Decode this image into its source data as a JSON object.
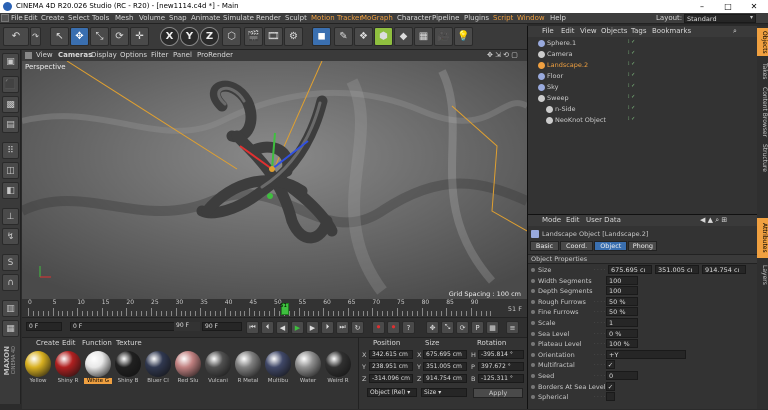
{
  "window": {
    "title": "CINEMA 4D R20.026 Studio (RC - R20) - [new1114.c4d *] - Main"
  },
  "menu": [
    "File",
    "Edit",
    "Create",
    "Select",
    "Tools",
    "Mesh",
    "Volume",
    "Snap",
    "Animate",
    "Simulate",
    "Render",
    "Sculpt",
    "Motion Tracker",
    "MoGraph",
    "Character",
    "Pipeline",
    "Plugins",
    "Script",
    "Window",
    "Help"
  ],
  "layout": {
    "label": "Layout:",
    "value": "Standard"
  },
  "viewport": {
    "menu": [
      "View",
      "Cameras",
      "Display",
      "Options",
      "Filter",
      "Panel",
      "ProRender"
    ],
    "name": "Perspective",
    "grid_spacing": "Grid Spacing : 100 cm"
  },
  "timeline": {
    "ticks": [
      "0",
      "5",
      "10",
      "15",
      "20",
      "25",
      "30",
      "35",
      "40",
      "45",
      "50",
      "55",
      "60",
      "65",
      "70",
      "75",
      "80",
      "85",
      "90"
    ],
    "current_marker": "51",
    "frame_end": "51 F"
  },
  "transport": {
    "start": "0 F",
    "current": "0 F",
    "end_a": "90 F",
    "end_b": "90 F"
  },
  "materials": {
    "menu": [
      "Create",
      "Edit",
      "Function",
      "Texture"
    ],
    "items": [
      {
        "label": "Yellow",
        "color": "#d8b020"
      },
      {
        "label": "Shiny R",
        "color": "#b02020"
      },
      {
        "label": "White G",
        "color": "#e8e8e8"
      },
      {
        "label": "Shiny B",
        "color": "#202020"
      },
      {
        "label": "Bluer Cl",
        "color": "#303850"
      },
      {
        "label": "Red Slu",
        "color": "#c08080"
      },
      {
        "label": "Vulcani",
        "color": "#505050"
      },
      {
        "label": "R Metal",
        "color": "#808080"
      },
      {
        "label": "Multibu",
        "color": "#404868"
      },
      {
        "label": "Water",
        "color": "#909090"
      },
      {
        "label": "Weird R",
        "color": "#303030"
      }
    ]
  },
  "coords": {
    "headers": [
      "Position",
      "Size",
      "Rotation"
    ],
    "rows": [
      {
        "axis": "X",
        "pos": "342.615 cm",
        "size": "675.695 cm",
        "rlabel": "H",
        "rot": "-395.814 °"
      },
      {
        "axis": "Y",
        "pos": "238.951 cm",
        "size": "351.005 cm",
        "rlabel": "P",
        "rot": "397.672 °"
      },
      {
        "axis": "Z",
        "pos": "-314.096 cm",
        "size": "914.754 cm",
        "rlabel": "B",
        "rot": "-125.311 °"
      }
    ],
    "mode": "Object (Rel)",
    "size_mode": "Size",
    "apply": "Apply"
  },
  "objects": {
    "menu": [
      "File",
      "Edit",
      "View",
      "Objects",
      "Tags",
      "Bookmarks"
    ],
    "items": [
      {
        "name": "Sphere.1",
        "indent": 0,
        "color": "#9ad"
      },
      {
        "name": "Camera",
        "indent": 0,
        "color": "#ccc"
      },
      {
        "name": "Landscape.2",
        "indent": 0,
        "color": "#f0a040"
      },
      {
        "name": "Floor",
        "indent": 0,
        "color": "#9ad"
      },
      {
        "name": "Sky",
        "indent": 0,
        "color": "#9ad"
      },
      {
        "name": "Sweep",
        "indent": 0,
        "color": "#ccc"
      },
      {
        "name": "n-Side",
        "indent": 1,
        "color": "#ccc"
      },
      {
        "name": "NeoKnot Object",
        "indent": 1,
        "color": "#ccc"
      }
    ]
  },
  "attributes": {
    "menu": [
      "Mode",
      "Edit",
      "User Data"
    ],
    "object": "Landscape Object [Landscape.2]",
    "tabs": [
      "Basic",
      "Coord.",
      "Object",
      "Phong"
    ],
    "active_tab": "Object",
    "section": "Object Properties",
    "props": [
      {
        "label": "Size",
        "values": [
          "675.695 cı",
          "351.005 cı",
          "914.754 cı"
        ]
      },
      {
        "label": "Width Segments",
        "values": [
          "100"
        ]
      },
      {
        "label": "Depth Segments",
        "values": [
          "100"
        ]
      },
      {
        "label": "Rough Furrows",
        "values": [
          "50 %"
        ]
      },
      {
        "label": "Fine Furrows",
        "values": [
          "50 %"
        ]
      },
      {
        "label": "Scale",
        "values": [
          "1"
        ]
      },
      {
        "label": "Sea Level",
        "values": [
          "0 %"
        ]
      },
      {
        "label": "Plateau Level",
        "values": [
          "100 %"
        ]
      },
      {
        "label": "Orientation",
        "values": [
          "+Y"
        ]
      },
      {
        "label": "Multifractal",
        "values": [
          "✓"
        ]
      },
      {
        "label": "Seed",
        "values": [
          "0"
        ]
      },
      {
        "label": "Borders At Sea Level",
        "values": [
          "✓"
        ]
      },
      {
        "label": "Spherical",
        "values": [
          ""
        ]
      }
    ]
  },
  "side_tabs": [
    "Objects",
    "Takes",
    "Content Browser",
    "Structure",
    "Attributes",
    "Layers"
  ],
  "brand": {
    "line1": "MAXON",
    "line2": "CINEMA 4D"
  }
}
